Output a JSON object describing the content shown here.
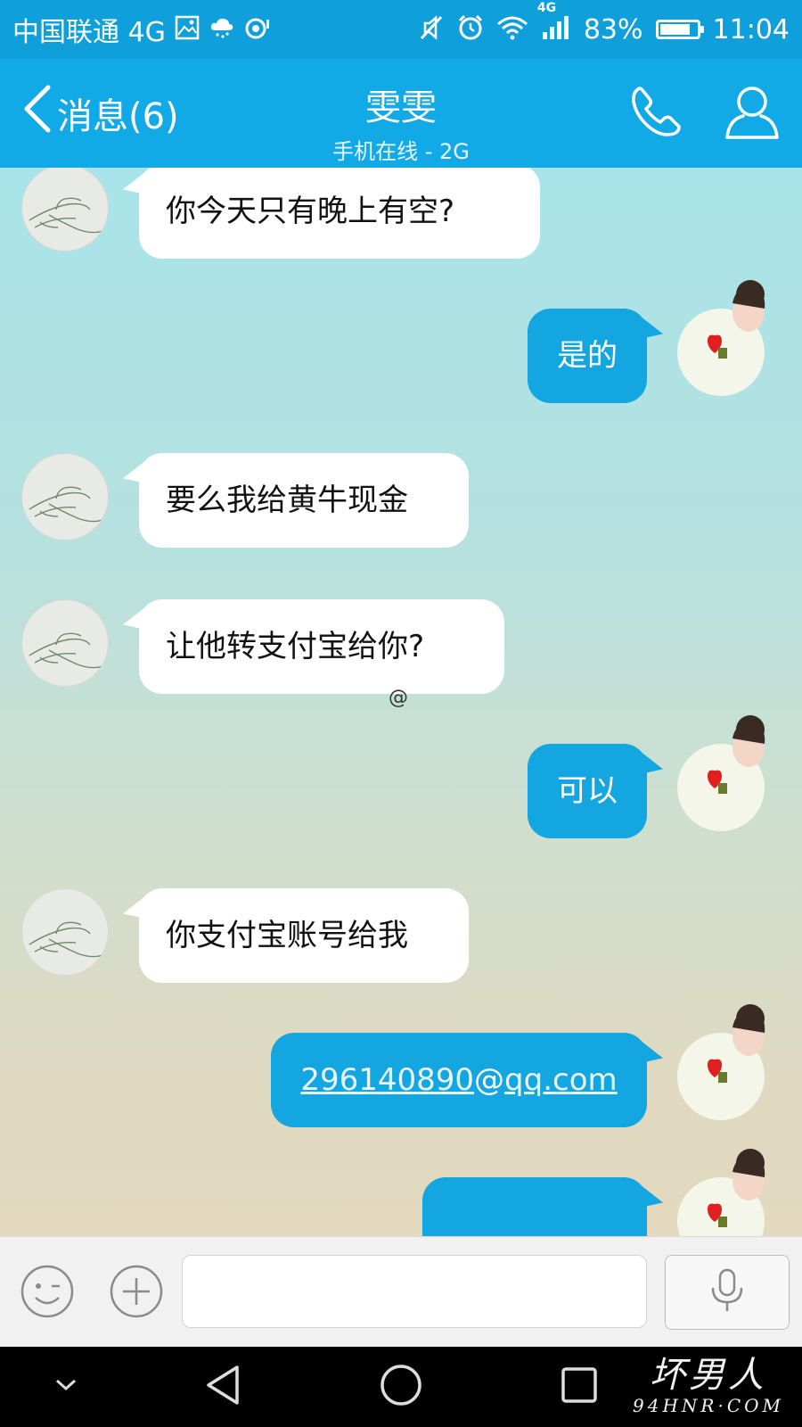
{
  "status_bar": {
    "carrier": "中国联通 4G",
    "network_badge": "4G",
    "battery": "83%",
    "battery_level": 0.83,
    "time": "11:04",
    "icons": [
      "gallery-icon",
      "weather-icon",
      "camera-icon",
      "mute-icon",
      "alarm-icon",
      "wifi-icon",
      "signal-icon",
      "battery-icon"
    ]
  },
  "header": {
    "back_label": "消息(6)",
    "contact_name": "雯雯",
    "contact_status": "手机在线 - 2G",
    "icons": [
      "back-chevron-icon",
      "phone-icon",
      "profile-icon"
    ]
  },
  "messages": [
    {
      "side": "in",
      "text": "你今天只有晚上有空?"
    },
    {
      "side": "out",
      "text": "是的"
    },
    {
      "side": "in",
      "text": "要么我给黄牛现金"
    },
    {
      "side": "in",
      "text": "让他转支付宝给你?"
    },
    {
      "side": "out",
      "text": "可以"
    },
    {
      "side": "in",
      "text": "你支付宝账号给我"
    },
    {
      "side": "out",
      "text_parts": [
        "296140890",
        "@",
        "qq.com"
      ]
    },
    {
      "side": "out",
      "text": ""
    }
  ],
  "stray_mark": "@",
  "input_bar": {
    "placeholder": "",
    "icons": [
      "emoji-icon",
      "plus-icon",
      "microphone-icon"
    ]
  },
  "nav_bar": {
    "icons": [
      "chevron-down-icon",
      "back-triangle-icon",
      "home-circle-icon",
      "recents-square-icon"
    ]
  },
  "watermark": {
    "text": "坏男人",
    "subtext": "94HNR·COM"
  },
  "colors": {
    "status_bar": "#0fa0dc",
    "title_bar": "#12aae6",
    "outgoing_bubble": "#13a6e0",
    "incoming_bubble": "#ffffff",
    "nav_bar": "#000000"
  }
}
